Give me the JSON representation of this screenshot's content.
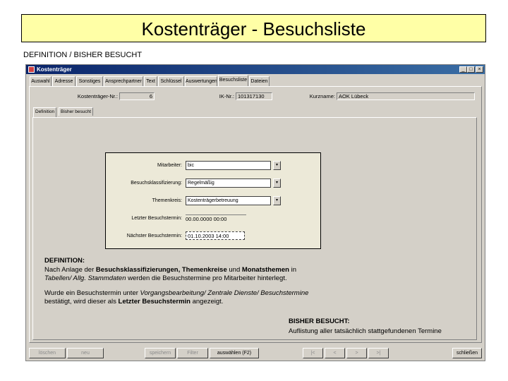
{
  "slide": {
    "title": "Kostenträger - Besuchsliste",
    "caption": "DEFINITION / BISHER BESUCHT"
  },
  "window": {
    "title": "Kostenträger",
    "controls": [
      "_",
      "□",
      "×"
    ],
    "tabs": [
      "Auswahl",
      "Adresse",
      "Sonstiges",
      "Ansprechpartner",
      "Text",
      "Schlüssel",
      "Auswertungen",
      "Besuchsliste",
      "Dateien"
    ],
    "active_tab": "Besuchsliste"
  },
  "header_fields": {
    "kostentraeger_nr_label": "Kostenträger-Nr.:",
    "kostentraeger_nr_value": "6",
    "ik_nr_label": "IK-Nr.:",
    "ik_nr_value": "101317130",
    "kurzname_label": "Kurzname:",
    "kurzname_value": "AOK Lübeck"
  },
  "subtabs": [
    "Definition",
    "Bisher besucht"
  ],
  "form": {
    "mitarbeiter_label": "Mitarbeiter:",
    "mitarbeiter_value": "bic",
    "klassifizierung_label": "Besuchsklassifizierung:",
    "klassifizierung_value": "Regelmäßig",
    "themenkreis_label": "Themenkreis:",
    "themenkreis_value": "Kostenträgerbetreuung",
    "letzter_label": "Letzter Besuchstermin:",
    "letzter_value": "00.00.0000 00:00",
    "naechster_label": "Nächster Besuchstermin:",
    "naechster_value": "01.10.2003 14:00"
  },
  "definition_text": {
    "heading": "DEFINITION:",
    "p1_a": "Nach Anlage der ",
    "p1_b": "Besuchsklassifizierungen, Themenkreise",
    "p1_c": " und ",
    "p1_d": "Monatsthemen",
    "p1_e": " in",
    "p1_f": "Tabellen/ Allg. Stammdaten",
    "p1_g": " werden die Besuchstermine pro Mitarbeiter hinterlegt.",
    "p2_a": "Wurde ein Besuchstermin unter ",
    "p2_b": "Vorgangsbearbeitung/ Zentrale Dienste/ Besuchstermine",
    "p2_c": "bestätigt,  wird dieser als ",
    "p2_d": "Letzter Besuchstermin",
    "p2_e": " angezeigt."
  },
  "bisher_text": {
    "heading": "BISHER BESUCHT:",
    "body": "Auflistung aller tatsächlich stattgefundenen Termine"
  },
  "bottom_bar": {
    "buttons": [
      "löschen",
      "neu",
      "speichern",
      "Filter",
      "auswählen (F2)",
      "|<",
      "<",
      ">",
      ">|",
      "schließen"
    ]
  }
}
